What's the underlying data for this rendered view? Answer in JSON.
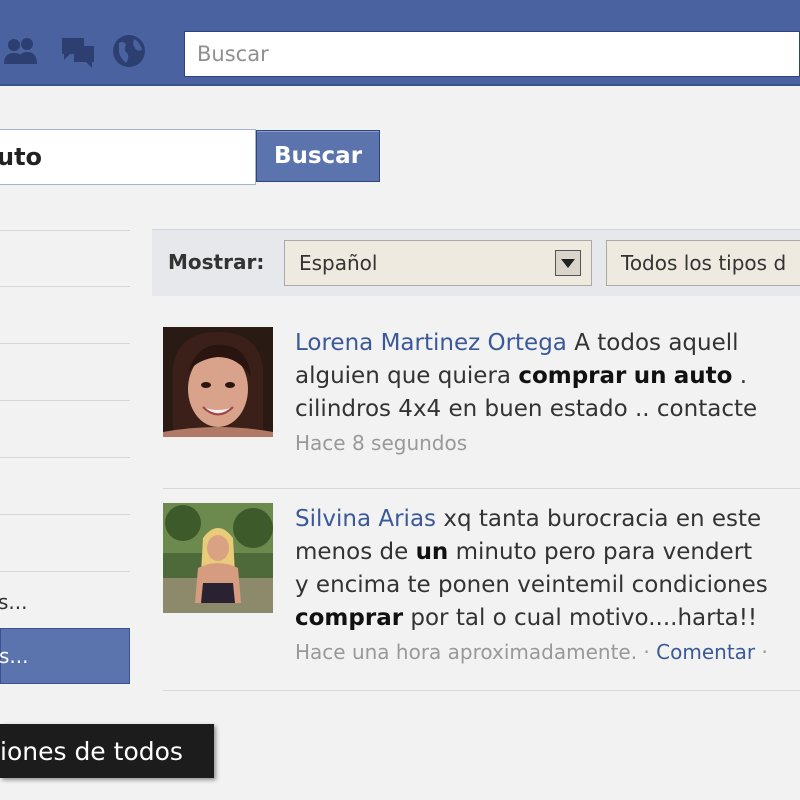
{
  "header": {
    "search_placeholder": "Buscar",
    "icons": [
      "friends-icon",
      "messages-icon",
      "globe-icon"
    ]
  },
  "search": {
    "query": "uto",
    "button_label": "Buscar"
  },
  "sidebar": {
    "items": [
      {
        "label": "s..."
      },
      {
        "label": "s..."
      }
    ]
  },
  "tooltip": {
    "text": "iones de todos"
  },
  "filters": {
    "label": "Mostrar:",
    "language": "Español",
    "type": "Todos los tipos d"
  },
  "posts": [
    {
      "author": "Lorena Martinez Ortega",
      "line1": " A todos aquell",
      "line2_a": "alguien que quiera ",
      "line2_b": "comprar",
      "line2_c": " ",
      "line2_d": "un",
      "line2_e": " ",
      "line2_f": "auto",
      "line2_g": " .",
      "line3": "cilindros 4x4 en buen estado .. contacte",
      "time": "Hace 8 segundos"
    },
    {
      "author": "Silvina Arias",
      "line1": " xq tanta burocracia en este",
      "line2_a": "menos de ",
      "line2_b": "un",
      "line2_c": " minuto pero para vendert",
      "line3": "y encima te ponen veintemil condiciones",
      "line4_a": "comprar",
      "line4_b": " por tal o cual motivo....harta!!",
      "time": "Hace una hora aproximadamente.",
      "sep": " · ",
      "comment": "Comentar",
      "trail": " ·"
    }
  ],
  "colors": {
    "topbar": "#4a62a0",
    "button": "#5b74ad",
    "link": "#3b5998"
  }
}
